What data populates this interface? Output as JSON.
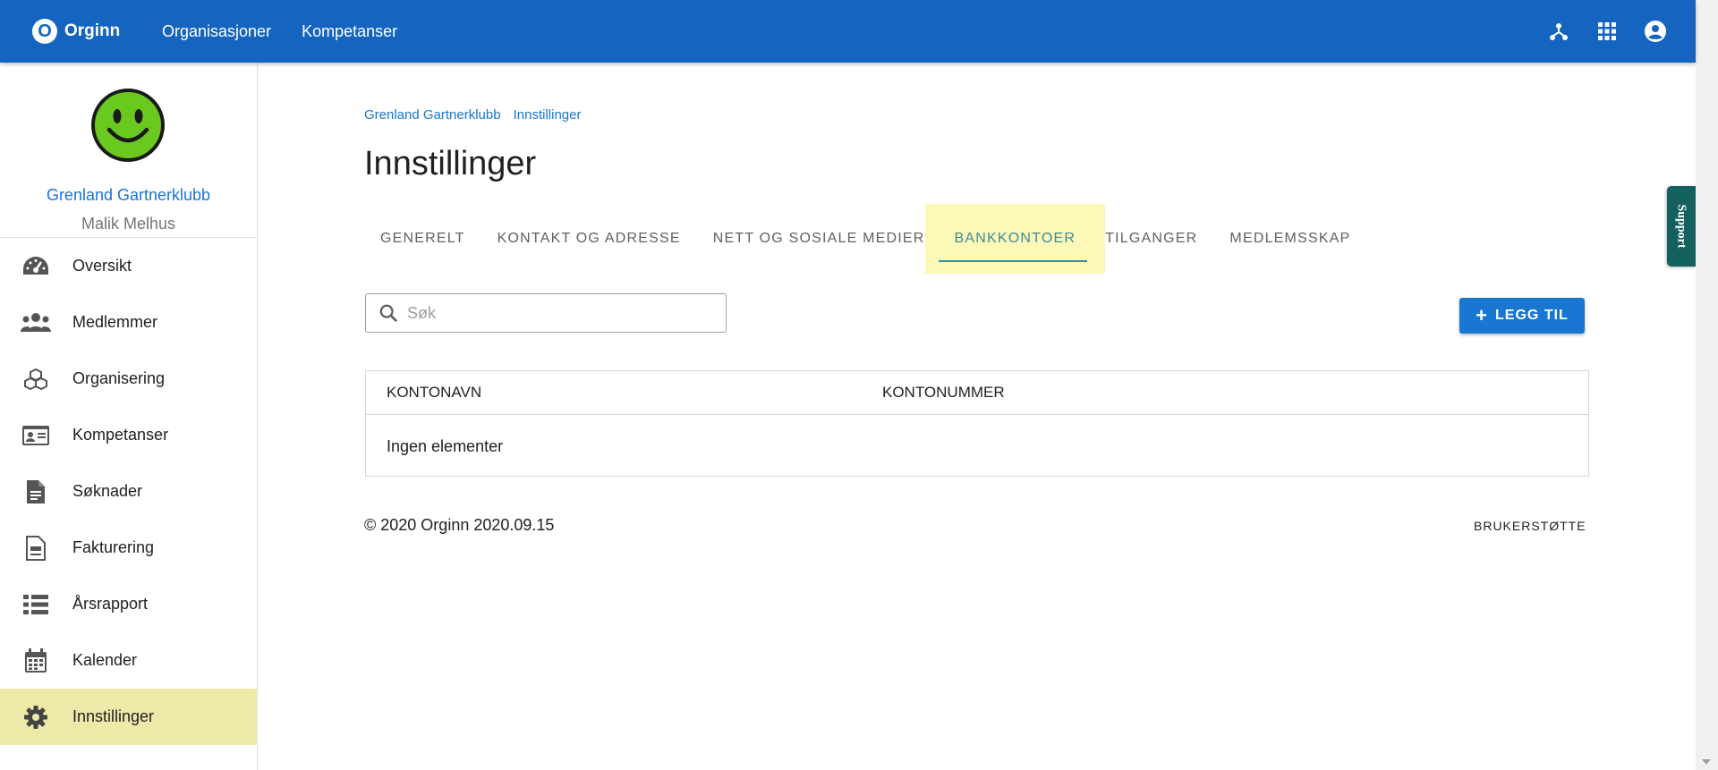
{
  "app": {
    "badge": "O",
    "name": "Orginn",
    "nav": [
      "Organisasjoner",
      "Kompetanser"
    ],
    "icons": [
      "hierarchy-icon",
      "apps-grid-icon",
      "account-circle-icon"
    ]
  },
  "sidebar": {
    "org_name": "Grenland Gartnerklubb",
    "user_name": "Malik Melhus",
    "items": [
      {
        "label": "Oversikt",
        "icon": "speedometer-icon"
      },
      {
        "label": "Medlemmer",
        "icon": "people-icon"
      },
      {
        "label": "Organisering",
        "icon": "cubes-icon"
      },
      {
        "label": "Kompetanser",
        "icon": "id-card-icon"
      },
      {
        "label": "Søknader",
        "icon": "document-icon"
      },
      {
        "label": "Fakturering",
        "icon": "invoice-icon"
      },
      {
        "label": "Årsrapport",
        "icon": "list-icon"
      },
      {
        "label": "Kalender",
        "icon": "calendar-icon"
      },
      {
        "label": "Innstillinger",
        "icon": "gear-icon",
        "active": true
      }
    ]
  },
  "main": {
    "breadcrumb": [
      "Grenland Gartnerklubb",
      "Innstillinger"
    ],
    "title": "Innstillinger",
    "tabs": [
      "GENERELT",
      "KONTAKT OG ADRESSE",
      "NETT OG SOSIALE MEDIER",
      "BANKKONTOER",
      "TILGANGER",
      "MEDLEMSSKAP"
    ],
    "active_tab": "BANKKONTOER",
    "search_placeholder": "Søk",
    "search_value": "",
    "add_button": "LEGG TIL",
    "table": {
      "columns": [
        "KONTONAVN",
        "KONTONUMMER"
      ],
      "empty_text": "Ingen elementer"
    },
    "footer": {
      "copyright": "© 2020 Orginn 2020.09.15",
      "support_link": "BRUKERSTØTTE"
    }
  },
  "support_tab": "Support",
  "colors": {
    "appbar": "#1565c0",
    "primary": "#1976d2",
    "active_tab_bg": "#fcf8b8",
    "active_tab_text": "#3e8c96",
    "active_menu_bg": "#ede9a8",
    "support_bg": "#14605e",
    "avatar_face": "#6ac91e"
  }
}
